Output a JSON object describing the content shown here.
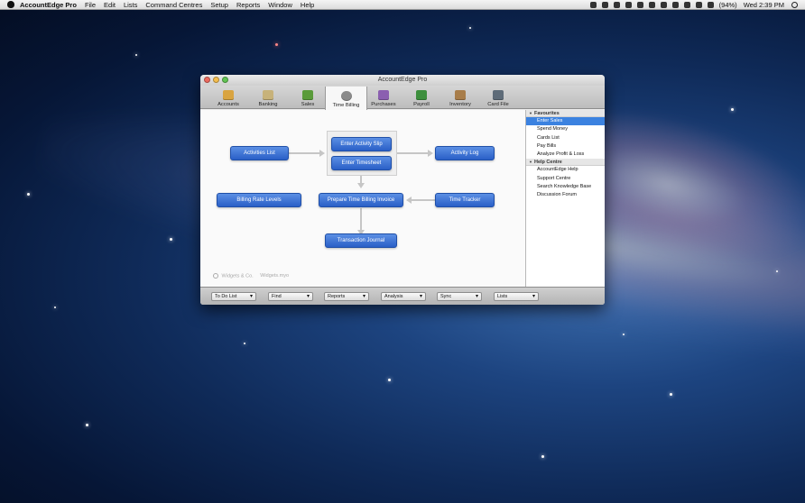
{
  "menubar": {
    "app_name": "AccountEdge Pro",
    "items": [
      "File",
      "Edit",
      "Lists",
      "Command Centres",
      "Setup",
      "Reports",
      "Window",
      "Help"
    ],
    "battery": "(94%)",
    "clock": "Wed 2:39 PM"
  },
  "window": {
    "title": "AccountEdge Pro",
    "tabs": [
      {
        "label": "Accounts",
        "color": "#d9a441"
      },
      {
        "label": "Banking",
        "color": "#c7b27a"
      },
      {
        "label": "Sales",
        "color": "#5a9b3a"
      },
      {
        "label": "Time Billing",
        "color": "#8a8a8a"
      },
      {
        "label": "Purchases",
        "color": "#8b5fb0"
      },
      {
        "label": "Payroll",
        "color": "#3d8f3d"
      },
      {
        "label": "Inventory",
        "color": "#a87d4a"
      },
      {
        "label": "Card File",
        "color": "#5e6b78"
      }
    ],
    "active_tab": "Time Billing"
  },
  "flow": {
    "activities_list": "Activities List",
    "enter_activity_slip": "Enter Activity Slip",
    "enter_timesheet": "Enter Timesheet",
    "activity_log": "Activity Log",
    "billing_rate_levels": "Billing Rate Levels",
    "prepare_invoice": "Prepare Time Billing Invoice",
    "time_tracker": "Time Tracker",
    "transaction_journal": "Transaction Journal"
  },
  "footer_logo": {
    "company": "Widgets & Co.",
    "file": "Widgets.myo"
  },
  "sidebar": {
    "favourites_title": "Favourites",
    "favourites": [
      "Enter Sales",
      "Spend Money",
      "Cards List",
      "Pay Bills",
      "Analyze Profit & Loss"
    ],
    "help_title": "Help Centre",
    "help": [
      "AccountEdge Help",
      "Support Centre",
      "Search Knowledge Base",
      "Discussion Forum"
    ]
  },
  "bottombar": [
    "To Do List",
    "Find",
    "Reports",
    "Analysis",
    "Sync",
    "Lists"
  ],
  "colors": {
    "accent": "#2a5fc7",
    "selection": "#3b82e0"
  }
}
